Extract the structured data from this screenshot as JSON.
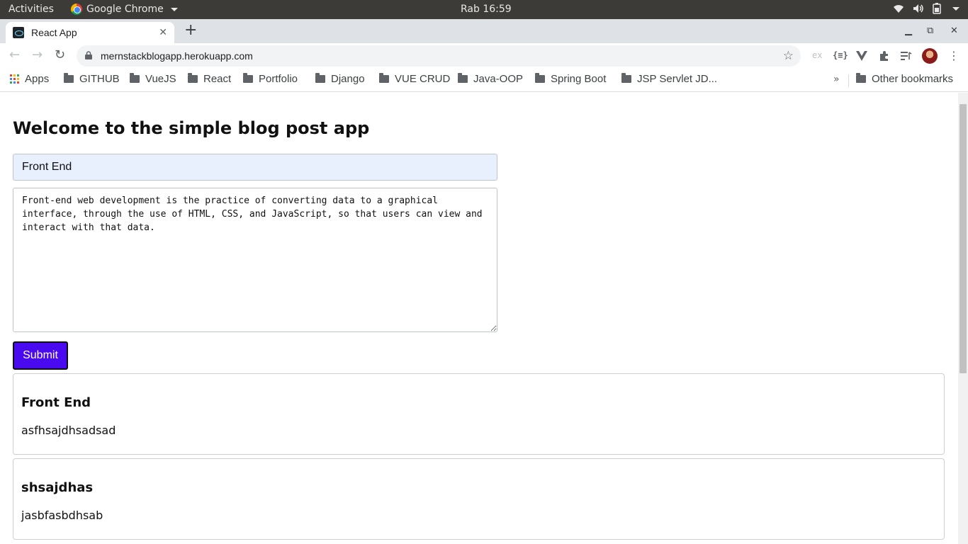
{
  "system_bar": {
    "activities": "Activities",
    "app_name": "Google Chrome",
    "clock": "Rab 16:59"
  },
  "browser": {
    "tab_title": "React App",
    "url": "mernstackblogapp.herokuapp.com",
    "extension_ex": "ex",
    "extension_json": "{≡}",
    "bookmarks": [
      {
        "label": "Apps",
        "icon": "apps-icon"
      },
      {
        "label": "GITHUB",
        "icon": "folder-icon"
      },
      {
        "label": "VueJS",
        "icon": "folder-icon"
      },
      {
        "label": "React",
        "icon": "folder-icon"
      },
      {
        "label": "Portfolio",
        "icon": "folder-icon"
      },
      {
        "label": "Django",
        "icon": "folder-icon"
      },
      {
        "label": "VUE CRUD",
        "icon": "folder-icon"
      },
      {
        "label": "Java-OOP",
        "icon": "folder-icon"
      },
      {
        "label": "Spring Boot",
        "icon": "folder-icon"
      },
      {
        "label": "JSP Servlet JD...",
        "icon": "folder-icon"
      }
    ],
    "other_bookmarks": "Other bookmarks"
  },
  "page": {
    "heading": "Welcome to the simple blog post app",
    "form": {
      "title_value": "Front End",
      "body_value": "Front-end web development is the practice of converting data to a graphical interface, through the use of HTML, CSS, and JavaScript, so that users can view and interact with that data.",
      "submit_label": "Submit"
    },
    "posts": [
      {
        "title": "Front End",
        "body": "asfhsajdhsadsad"
      },
      {
        "title": "shsajdhas",
        "body": "jasbfasbdhsab"
      }
    ]
  }
}
